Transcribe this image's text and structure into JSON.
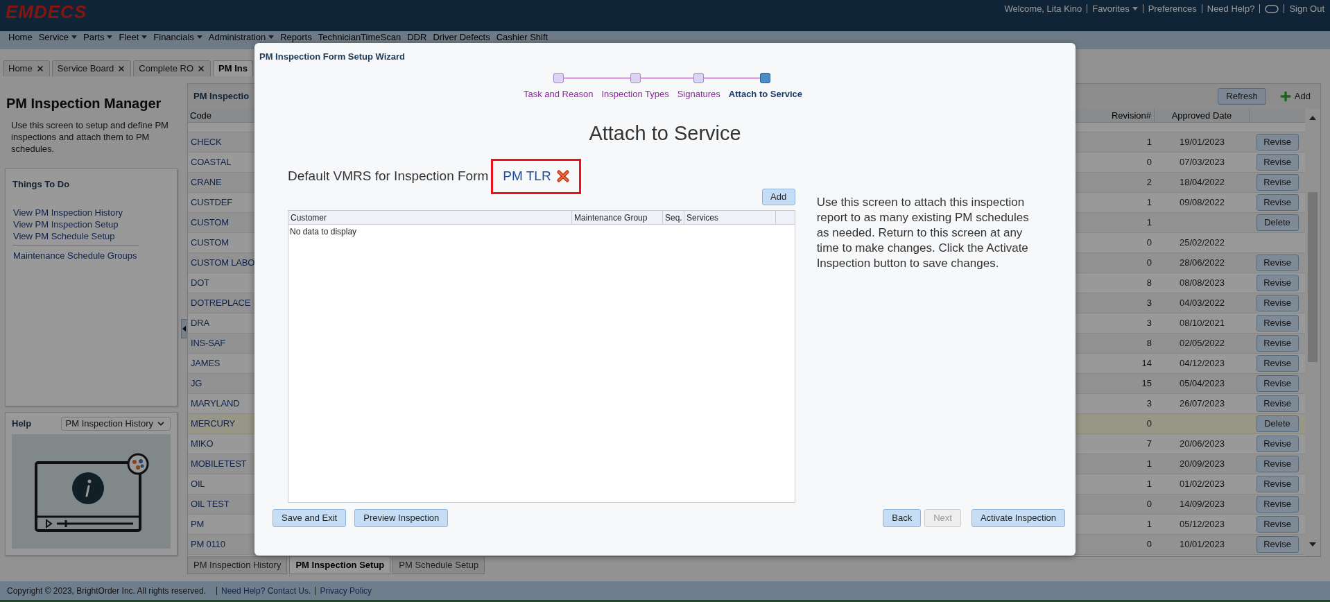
{
  "header": {
    "logo": "EMDECS",
    "items": [
      {
        "kind": "text",
        "label": "Welcome, Lita Kino"
      },
      {
        "kind": "menu",
        "label": "Favorites"
      },
      {
        "kind": "link",
        "label": "Preferences"
      },
      {
        "kind": "link",
        "label": "Need Help?"
      },
      {
        "kind": "chat"
      },
      {
        "kind": "link",
        "label": "Sign Out"
      }
    ]
  },
  "nav_menu": [
    {
      "label": "Home",
      "dropdown": false
    },
    {
      "label": "Service",
      "dropdown": true
    },
    {
      "label": "Parts",
      "dropdown": true
    },
    {
      "label": "Fleet",
      "dropdown": true
    },
    {
      "label": "Financials",
      "dropdown": true
    },
    {
      "label": "Administration",
      "dropdown": true
    },
    {
      "label": "Reports",
      "dropdown": false
    },
    {
      "label": "TechnicianTimeScan",
      "dropdown": false
    },
    {
      "label": "DDR",
      "dropdown": false
    },
    {
      "label": "Driver Defects",
      "dropdown": false
    },
    {
      "label": "Cashier Shift",
      "dropdown": false
    }
  ],
  "tabs": [
    {
      "label": "Home",
      "closable": true,
      "selected": false
    },
    {
      "label": "Service Board",
      "closable": true,
      "selected": false
    },
    {
      "label": "Complete RO",
      "closable": true,
      "selected": false
    },
    {
      "label": "PM Ins",
      "closable": false,
      "selected": true
    }
  ],
  "left_panel": {
    "title": "PM Inspection Manager",
    "description": "Use this screen to setup and define PM inspections and attach them to PM schedules.",
    "things_to_do": {
      "title": "Things To Do",
      "groups": [
        [
          "View PM Inspection History",
          "View PM Inspection Setup",
          "View PM Schedule Setup"
        ],
        [
          "Maintenance Schedule Groups"
        ]
      ]
    },
    "help": {
      "title": "Help",
      "select": "PM Inspection History"
    }
  },
  "table": {
    "title": "PM Inspectio",
    "buttons": [
      {
        "kind": "refresh",
        "label": "Refresh"
      },
      {
        "kind": "add",
        "label": "Add"
      }
    ],
    "columns": [
      "Code",
      "Revision#",
      "Approved Date"
    ],
    "rows": [
      {
        "code": "CHECK",
        "revision": "1",
        "date": "19/01/2023",
        "action": "Revise",
        "selected": false
      },
      {
        "code": "COASTAL",
        "revision": "0",
        "date": "07/03/2023",
        "action": "Revise",
        "selected": false
      },
      {
        "code": "CRANE",
        "revision": "2",
        "date": "18/04/2022",
        "action": "Revise",
        "selected": false
      },
      {
        "code": "CUSTDEF",
        "revision": "1",
        "date": "09/08/2022",
        "action": "Revise",
        "selected": false
      },
      {
        "code": "CUSTOM",
        "revision": "1",
        "action": "Delete",
        "selected": false
      },
      {
        "code": "CUSTOM",
        "revision": "0",
        "date": "25/02/2022",
        "selected": false
      },
      {
        "code": "CUSTOM LABO",
        "revision": "0",
        "date": "28/06/2022",
        "action": "Revise",
        "selected": false
      },
      {
        "code": "DOT",
        "revision": "8",
        "date": "08/08/2023",
        "action": "Revise",
        "selected": false
      },
      {
        "code": "DOTREPLACE",
        "revision": "3",
        "date": "04/03/2022",
        "action": "Revise",
        "selected": false
      },
      {
        "code": "DRA",
        "revision": "3",
        "date": "08/10/2021",
        "action": "Revise",
        "selected": false
      },
      {
        "code": "INS-SAF",
        "revision": "8",
        "date": "02/05/2022",
        "action": "Revise",
        "selected": false
      },
      {
        "code": "JAMES",
        "revision": "14",
        "date": "04/12/2023",
        "action": "Revise",
        "selected": false
      },
      {
        "code": "JG",
        "revision": "15",
        "date": "05/04/2023",
        "action": "Revise",
        "selected": false
      },
      {
        "code": "MARYLAND",
        "revision": "3",
        "date": "26/07/2023",
        "action": "Revise",
        "selected": false
      },
      {
        "code": "MERCURY",
        "revision": "0",
        "action": "Delete",
        "selected": true
      },
      {
        "code": "MIKO",
        "revision": "7",
        "date": "20/06/2023",
        "action": "Revise",
        "selected": false
      },
      {
        "code": "MOBILETEST",
        "revision": "1",
        "date": "20/09/2023",
        "action": "Revise",
        "selected": false
      },
      {
        "code": "OIL",
        "revision": "1",
        "date": "01/02/2023",
        "action": "Revise",
        "selected": false
      },
      {
        "code": "OIL TEST",
        "revision": "0",
        "date": "14/09/2023",
        "action": "Revise",
        "selected": false
      },
      {
        "code": "PM",
        "revision": "1",
        "date": "05/12/2023",
        "action": "Revise",
        "selected": false
      },
      {
        "code": "PM 0110",
        "revision": "0",
        "date": "10/01/2023",
        "action": "Revise",
        "selected": false
      }
    ]
  },
  "bottom_tabs": [
    {
      "label": "PM Inspection History",
      "selected": false
    },
    {
      "label": "PM Inspection Setup",
      "selected": true
    },
    {
      "label": "PM Schedule Setup",
      "selected": false
    }
  ],
  "footer": {
    "copyright": "Copyright © 2023, BrightOrder Inc. All rights reserved.",
    "links": [
      "Need Help? Contact Us.",
      "Privacy Policy"
    ]
  },
  "wizard": {
    "title": "PM Inspection Form Setup Wizard",
    "steps": [
      {
        "label": "Task and Reason",
        "selected": false
      },
      {
        "label": "Inspection Types",
        "selected": false
      },
      {
        "label": "Signatures",
        "selected": false
      },
      {
        "label": "Attach to Service",
        "selected": true
      }
    ],
    "heading": "Attach to Service",
    "vmrs": {
      "label": "Default VMRS for Inspection Form",
      "value": "PM TLR",
      "highlighted": true
    },
    "add_button": "Add",
    "grid": {
      "columns": [
        "Customer",
        "Maintenance Group",
        "Seq.",
        "Services"
      ],
      "empty_text": "No data to display"
    },
    "help_text": "Use this screen to attach this inspection report to as many existing PM schedules as needed. Return to this screen at any time to make changes. Click the Activate Inspection button to save changes.",
    "left_buttons": [
      {
        "label": "Save and Exit",
        "disabled": false
      },
      {
        "label": "Preview Inspection",
        "disabled": false
      }
    ],
    "right_buttons": [
      {
        "label": "Back",
        "disabled": false
      },
      {
        "label": "Next",
        "disabled": true
      },
      {
        "label": "Activate Inspection",
        "disabled": false
      }
    ]
  }
}
